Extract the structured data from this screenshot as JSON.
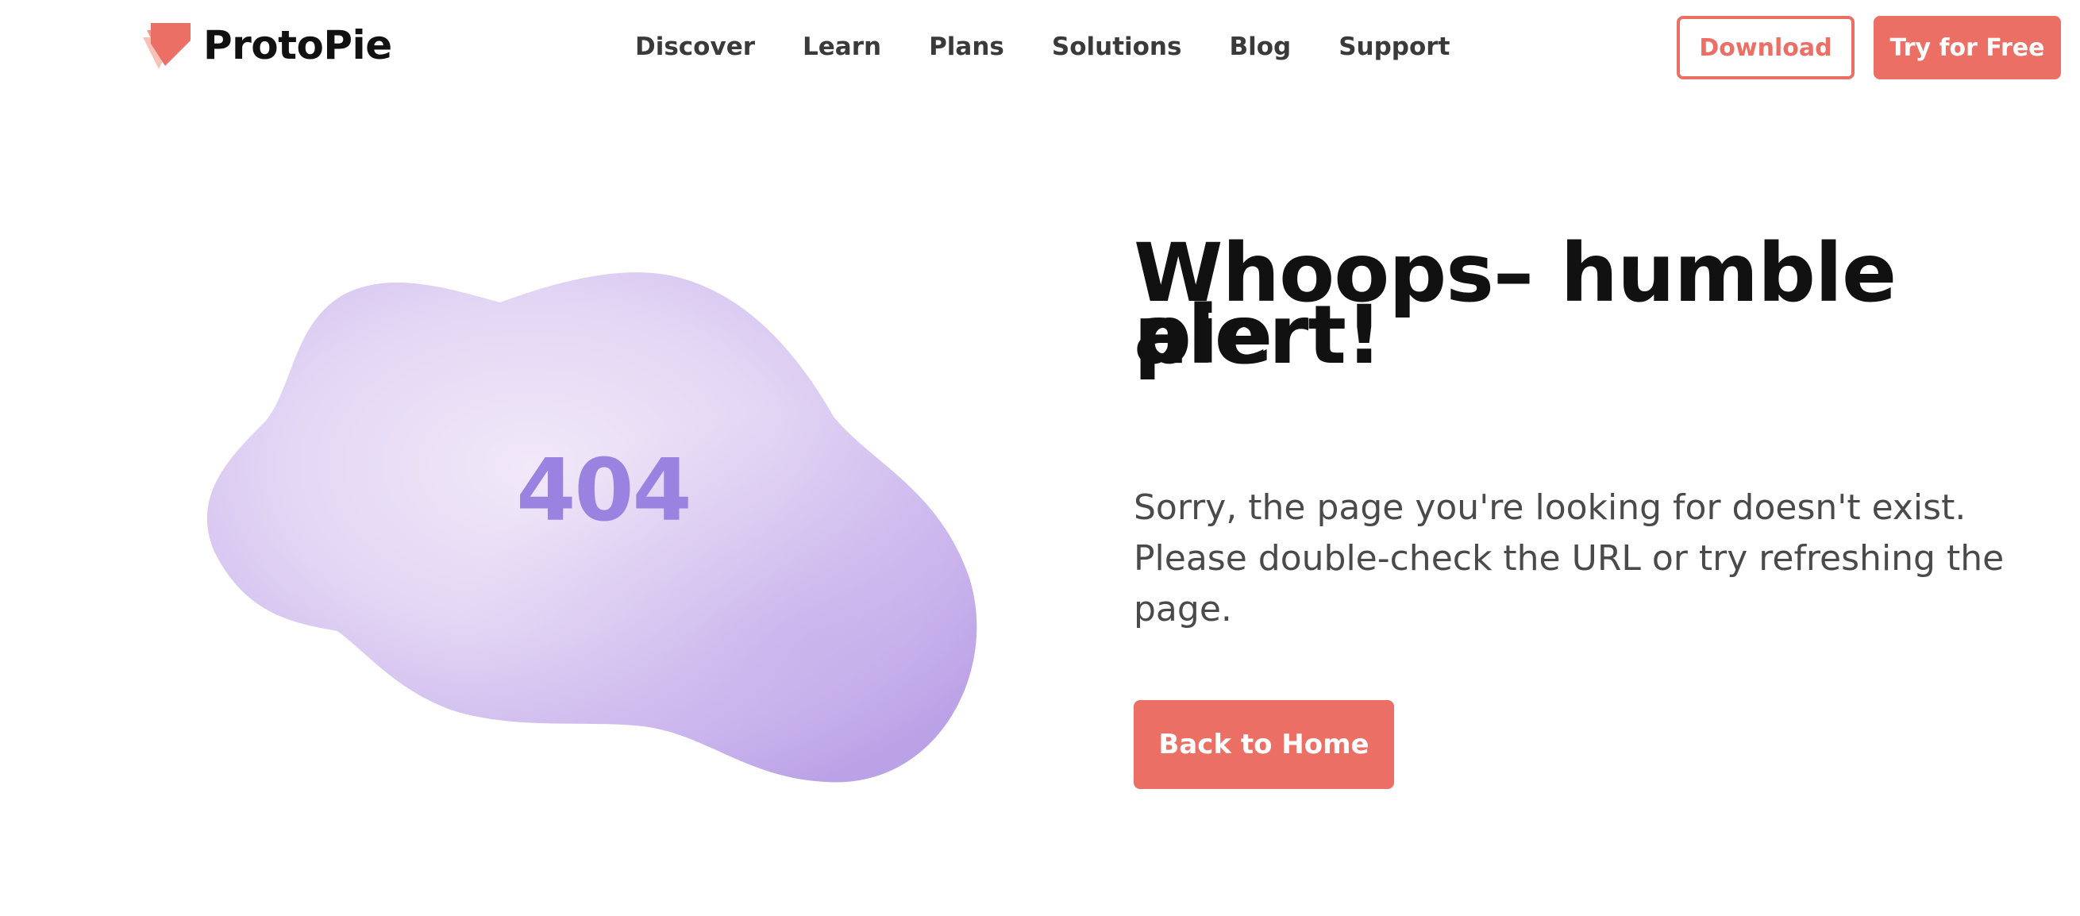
{
  "header": {
    "brand_name": "ProtoPie",
    "logo_icon": "protopie-logo-icon",
    "nav": [
      {
        "label": "Discover"
      },
      {
        "label": "Learn"
      },
      {
        "label": "Plans"
      },
      {
        "label": "Solutions"
      },
      {
        "label": "Blog"
      },
      {
        "label": "Support"
      }
    ],
    "download_label": "Download",
    "try_label": "Try for Free"
  },
  "hero": {
    "error_code": "404",
    "headline_line1": "Whoops– humble pie",
    "headline_line2": "alert!",
    "message": "Sorry, the page you're looking for doesn't exist. Please double-check the URL or try refreshing the page.",
    "home_button_label": "Back to Home"
  },
  "colors": {
    "accent": "#ec6f66",
    "cloud": "#d9c9f2",
    "error_code": "#9a82e0",
    "headline": "#111111",
    "body_text": "#4a4a4a"
  }
}
